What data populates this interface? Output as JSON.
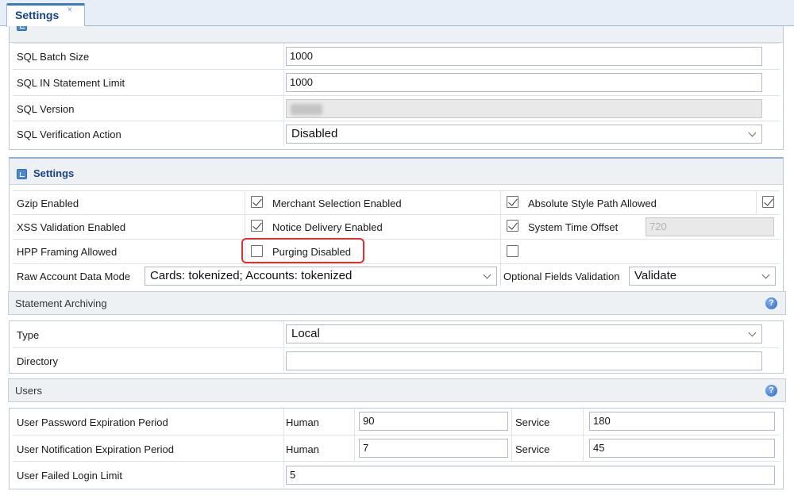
{
  "tab": {
    "label": "Settings",
    "close": "×"
  },
  "sql": {
    "rows": [
      {
        "label": "SQL Batch Size",
        "value": "1000"
      },
      {
        "label": "SQL IN Statement Limit",
        "value": "1000"
      },
      {
        "label": "SQL Version",
        "value": ""
      },
      {
        "label": "SQL Verification Action",
        "value": "Disabled"
      }
    ]
  },
  "settings": {
    "title": "Settings",
    "gzip_label": "Gzip Enabled",
    "merchant_label": "Merchant Selection Enabled",
    "absolute_label": "Absolute Style Path Allowed",
    "xss_label": "XSS Validation Enabled",
    "notice_label": "Notice Delivery Enabled",
    "time_offset_label": "System Time Offset",
    "time_offset_value": "720",
    "hpp_label": "HPP Framing Allowed",
    "purging_label": "Purging Disabled",
    "raw_label": "Raw Account Data Mode",
    "raw_value": "Cards: tokenized; Accounts: tokenized",
    "optional_label": "Optional Fields Validation",
    "optional_value": "Validate",
    "checks": {
      "gzip": true,
      "merchant": true,
      "absolute": true,
      "xss": true,
      "notice": true,
      "hpp": false,
      "purging": false
    }
  },
  "archiving": {
    "title": "Statement Archiving",
    "type_label": "Type",
    "type_value": "Local",
    "directory_label": "Directory",
    "directory_value": ""
  },
  "users": {
    "title": "Users",
    "pwd_label": "User Password Expiration Period",
    "notif_label": "User Notification Expiration Period",
    "failed_label": "User Failed Login Limit",
    "human_label": "Human",
    "service_label": "Service",
    "pwd_human": "90",
    "pwd_service": "180",
    "notif_human": "7",
    "notif_service": "45",
    "failed_value": "5"
  },
  "help_glyph": "?"
}
